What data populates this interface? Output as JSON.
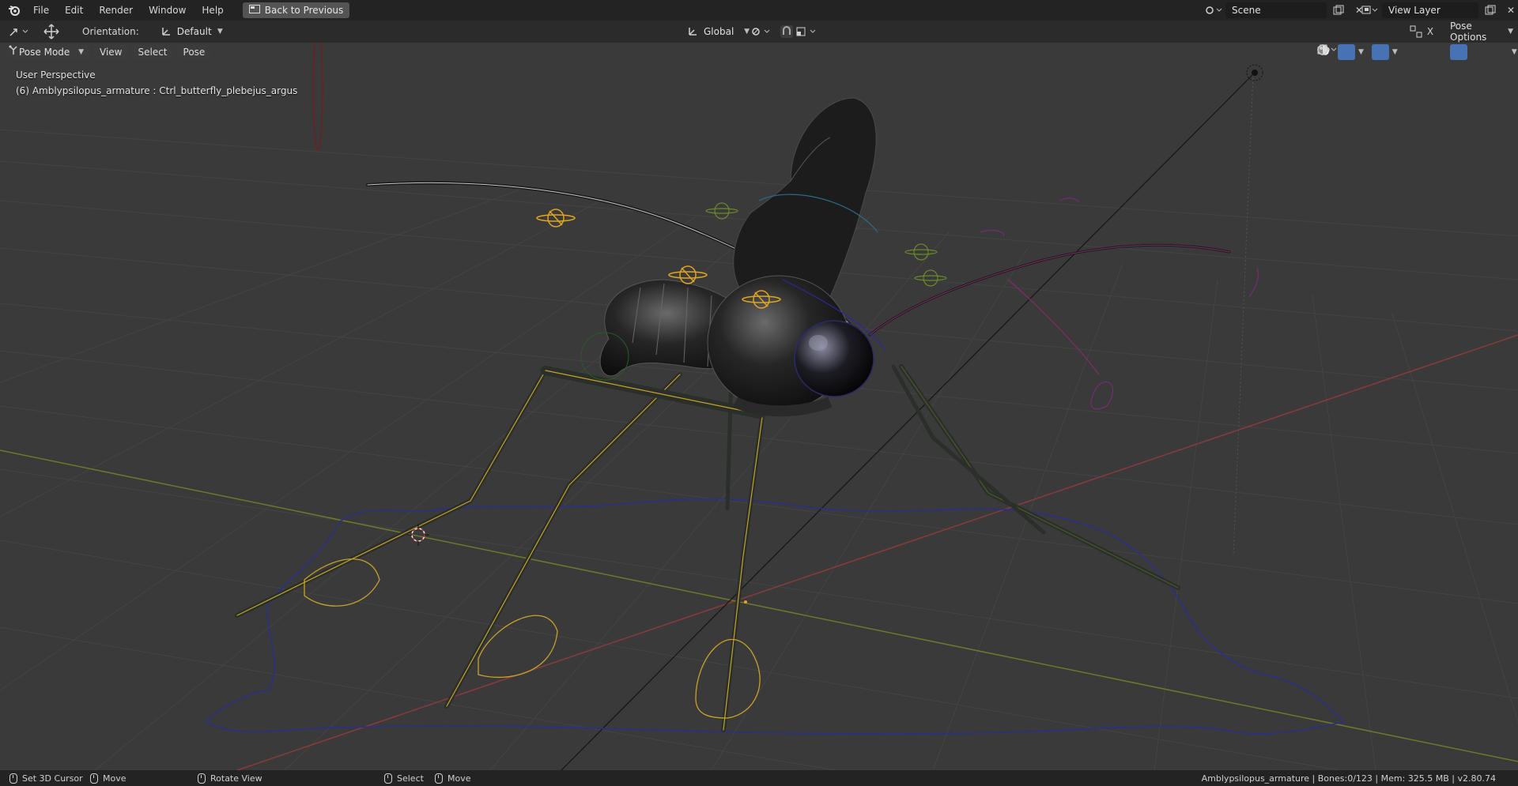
{
  "menubar": {
    "items": [
      "File",
      "Edit",
      "Render",
      "Window",
      "Help"
    ],
    "back_button": "Back to Previous",
    "scene_field": "Scene",
    "view_layer_field": "View Layer"
  },
  "toolbar": {
    "orientation_label": "Orientation:",
    "orientation_value": "Default",
    "transform_space": "Global",
    "pose_options": "Pose Options",
    "axis_x": "X"
  },
  "viewport_header": {
    "mode": "Pose Mode",
    "menus": [
      "View",
      "Select",
      "Pose"
    ]
  },
  "viewport": {
    "perspective": "User Perspective",
    "active_object": "(6) Amblypsilopus_armature : Ctrl_butterfly_plebejus_argus"
  },
  "statusbar": {
    "set_cursor": "Set 3D Cursor",
    "move1": "Move",
    "rotate": "Rotate View",
    "select": "Select",
    "move2": "Move",
    "info": "Amblypsilopus_armature | Bones:0/123 | Mem: 325.5 MB | v2.80.74"
  },
  "colors": {
    "accent": "#4772b3",
    "bone_selected": "#e3a521",
    "x_axis": "#8a3a3a",
    "y_axis": "#6b7a2a"
  },
  "icons": [
    "blender-logo-icon",
    "back-icon",
    "scene-icon",
    "view-layer-icon",
    "transform-icon",
    "move-gizmo-icon",
    "orientation-icon",
    "global-icon",
    "snap-icon",
    "proportional-icon",
    "pose-mode-icon",
    "visibility-icon",
    "gizmo-icon",
    "overlay-icon",
    "xray-icon",
    "wireframe-shading-icon",
    "solid-shading-icon",
    "material-shading-icon",
    "rendered-shading-icon",
    "light-icon",
    "mouse-icon"
  ]
}
